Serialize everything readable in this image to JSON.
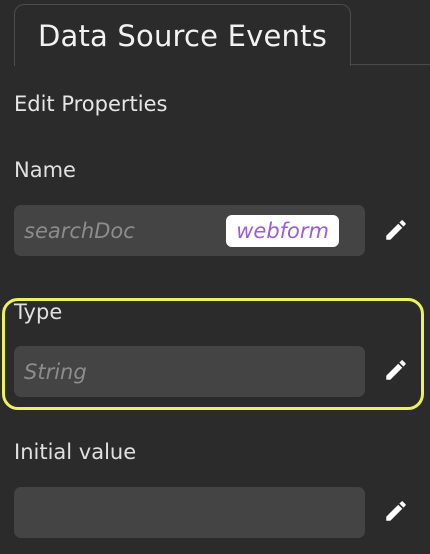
{
  "tabs": {
    "active_label": "Data Source Events"
  },
  "section": {
    "title": "Edit Properties"
  },
  "fields": {
    "name": {
      "label": "Name",
      "value": "searchDoc",
      "chip": "webform",
      "edit_icon": "pencil-icon"
    },
    "type": {
      "label": "Type",
      "value": "String",
      "edit_icon": "pencil-icon"
    },
    "initial_value": {
      "label": "Initial value",
      "value": "",
      "edit_icon": "pencil-icon"
    }
  },
  "colors": {
    "background": "#2b2b2b",
    "field_background": "#444444",
    "chip_text": "#9a5fd4",
    "highlight": "#eef25a"
  }
}
